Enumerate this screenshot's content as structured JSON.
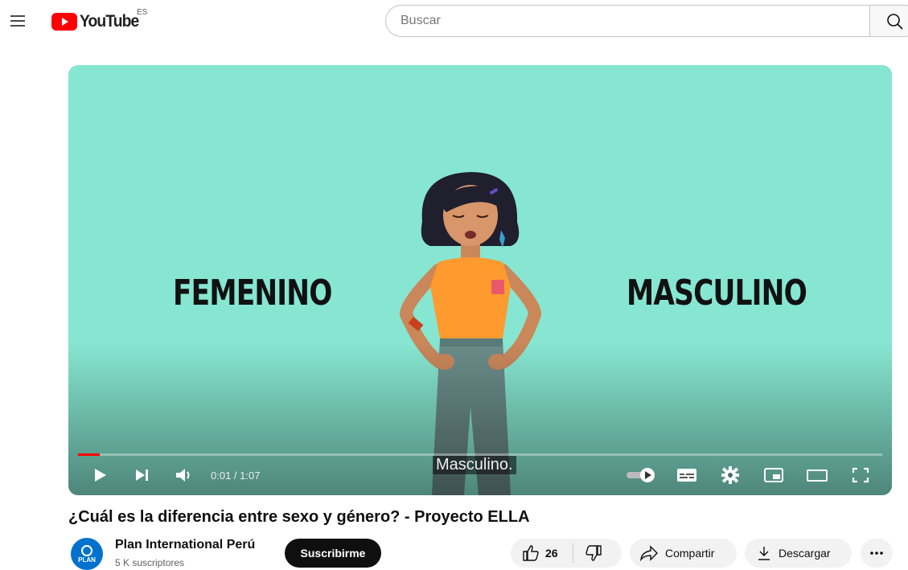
{
  "header": {
    "logo_text": "YouTube",
    "country_code": "ES",
    "search_placeholder": "Buscar"
  },
  "player": {
    "scene_word_left": "FEMENINO",
    "scene_word_right": "MASCULINO",
    "caption": "Masculino.",
    "time_display": "0:01 / 1:07",
    "progress": 0.027,
    "buffered": 0.027
  },
  "video": {
    "title": "¿Cuál es la diferencia entre sexo y género? - Proyecto ELLA"
  },
  "channel": {
    "name": "Plan International Perú",
    "subscribers": "5 K suscriptores",
    "avatar_text": "PLAN",
    "subscribe_label": "Suscribirme"
  },
  "actions": {
    "like_count": "26",
    "share_label": "Compartir",
    "download_label": "Descargar"
  },
  "colors": {
    "accent_red": "#ff0000",
    "scene_bg": "#86e6d1",
    "channel_blue": "#0072ce"
  }
}
